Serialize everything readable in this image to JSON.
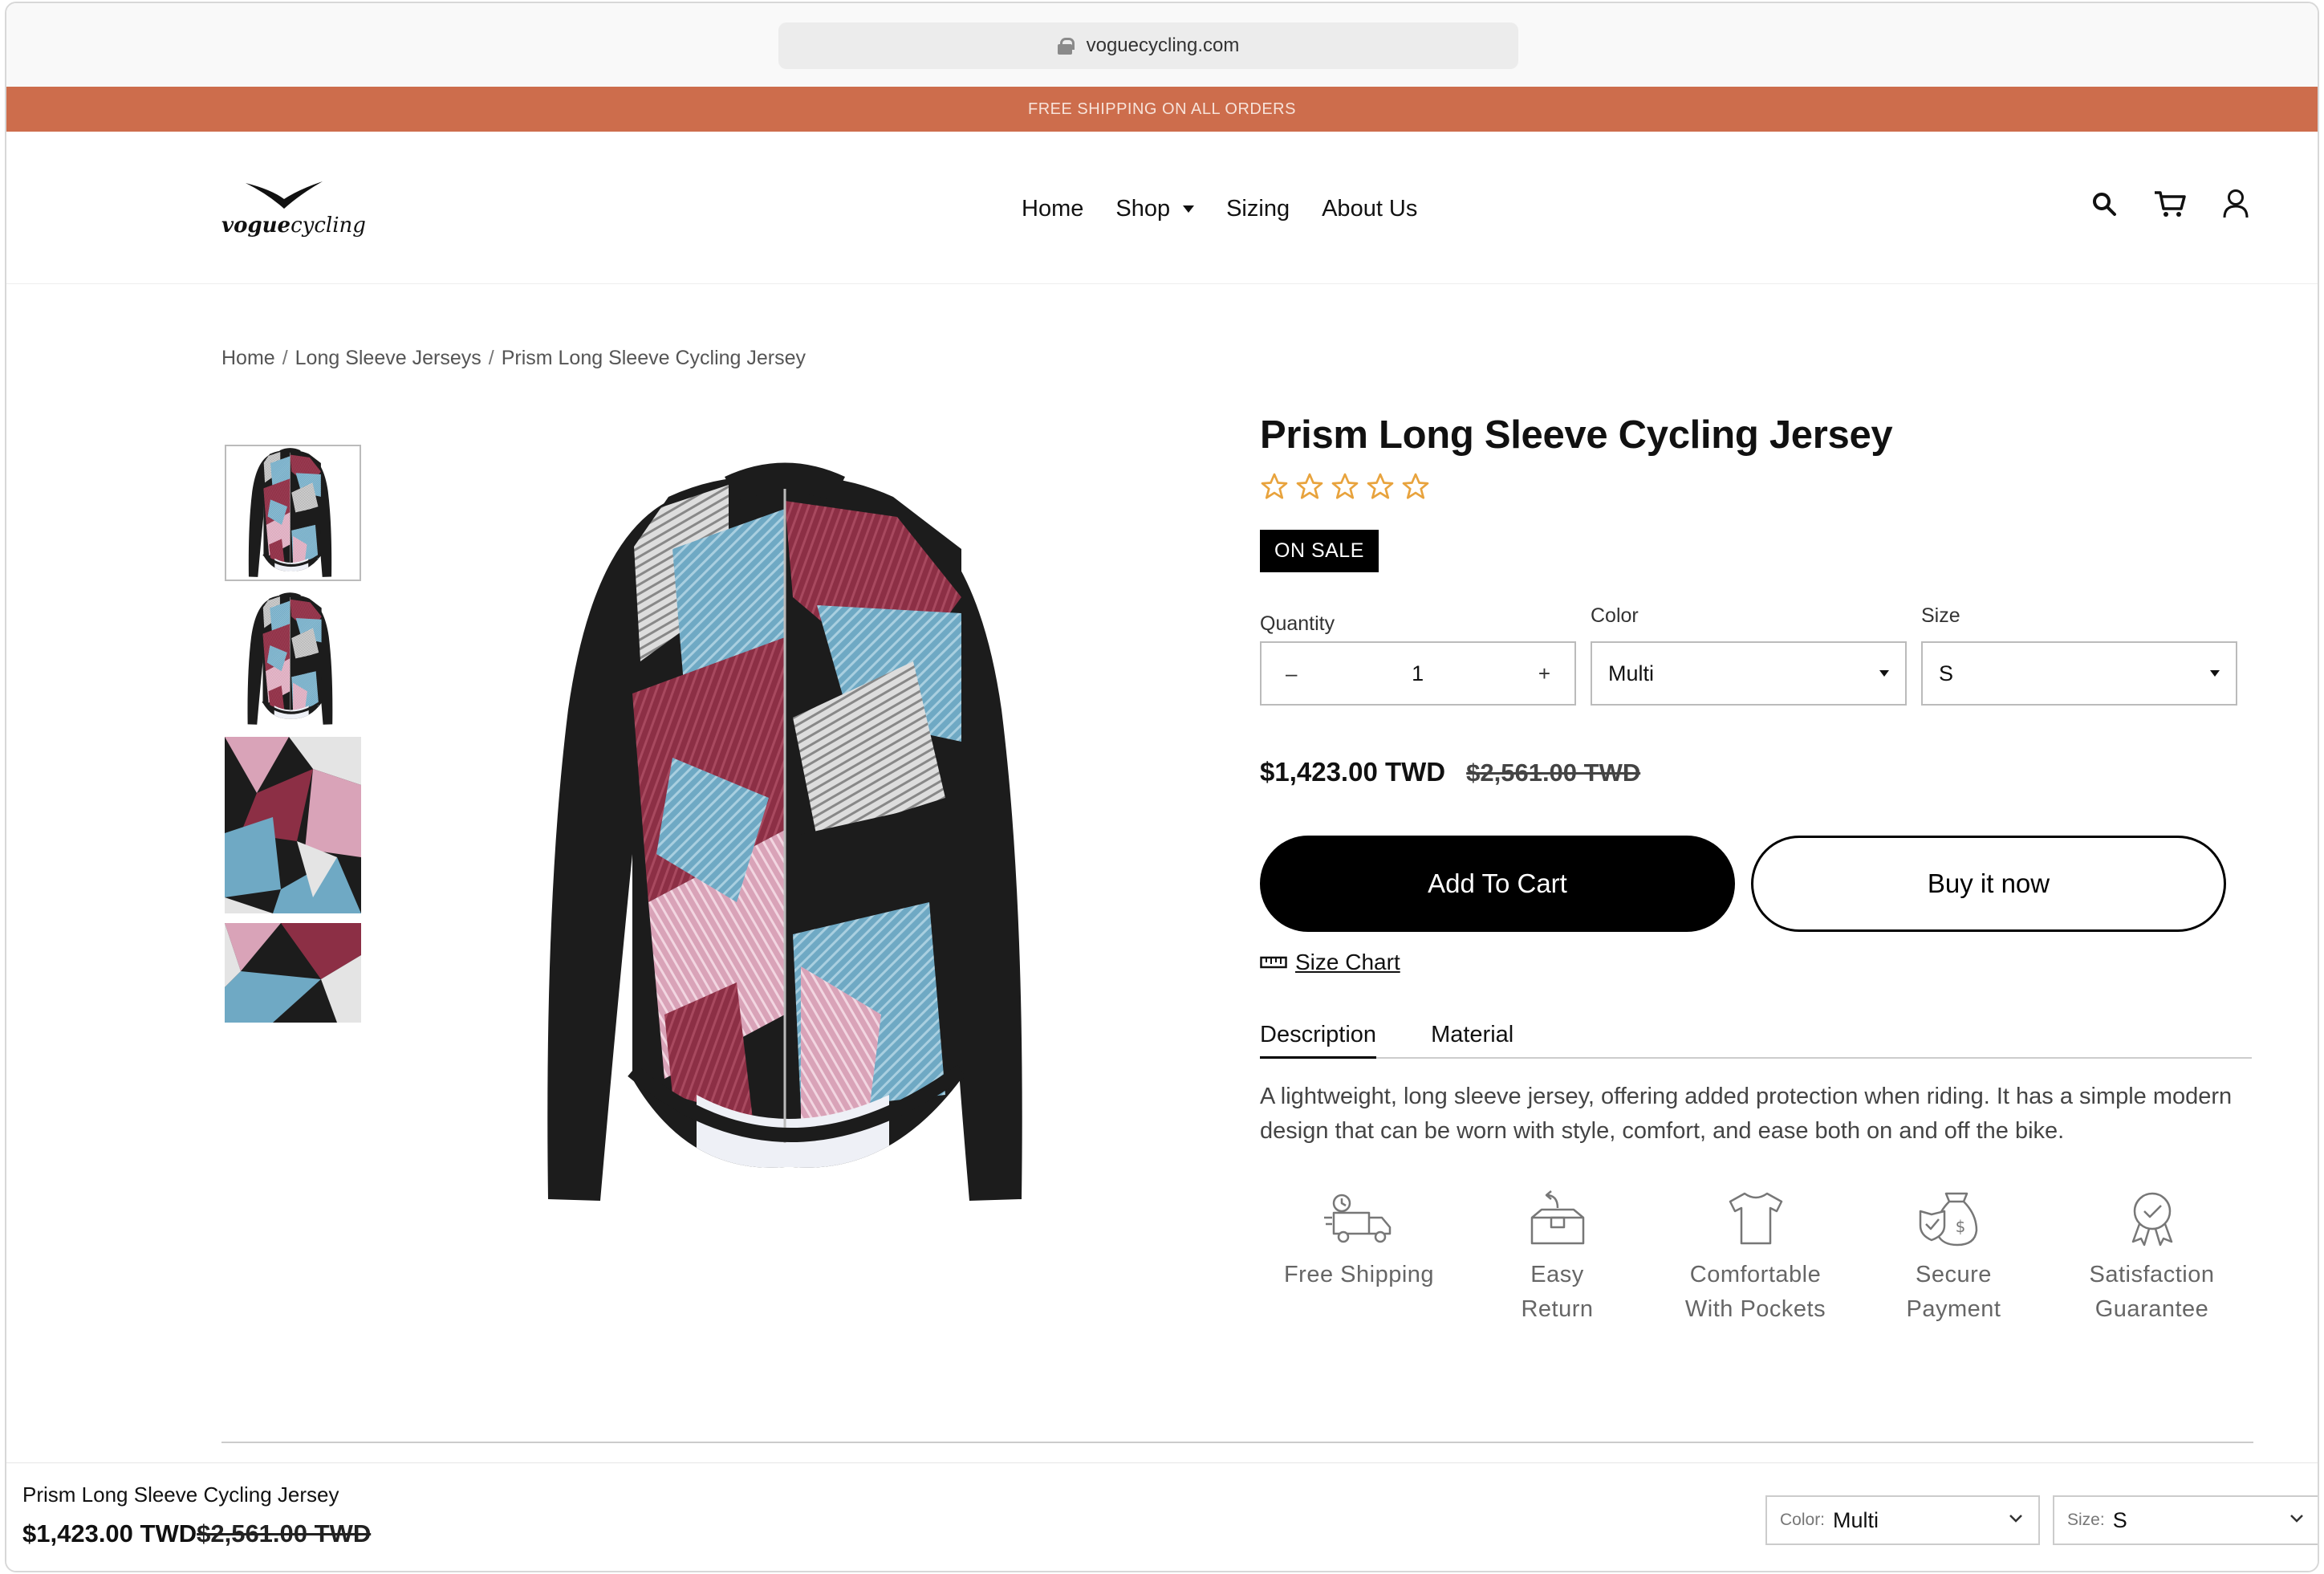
{
  "browser": {
    "url": "voguecycling.com"
  },
  "promo": {
    "text": "FREE SHIPPING ON ALL ORDERS"
  },
  "header": {
    "logo": {
      "bold": "vogue",
      "light": "cycling"
    },
    "nav": [
      {
        "label": "Home"
      },
      {
        "label": "Shop"
      },
      {
        "label": "Sizing"
      },
      {
        "label": "About Us"
      }
    ],
    "icons": [
      "search-icon",
      "cart-icon",
      "account-icon"
    ]
  },
  "breadcrumb": [
    "Home",
    "Long Sleeve Jerseys",
    "Prism Long Sleeve Cycling Jersey"
  ],
  "product": {
    "title": "Prism Long Sleeve Cycling Jersey",
    "rating": 0,
    "rating_max": 5,
    "badge": "ON SALE",
    "quantity": {
      "label": "Quantity",
      "value": "1",
      "minus": "–",
      "plus": "+"
    },
    "color": {
      "label": "Color",
      "value": "Multi"
    },
    "size": {
      "label": "Size",
      "value": "S"
    },
    "price_now": "$1,423.00 TWD",
    "price_was": "$2,561.00 TWD",
    "add_to_cart": "Add To Cart",
    "buy_now": "Buy it now",
    "size_chart": "Size Chart",
    "tabs": [
      {
        "label": "Description",
        "active": true
      },
      {
        "label": "Material",
        "active": false
      }
    ],
    "description": "A lightweight, long sleeve jersey, offering added protection when riding. It has a simple modern design that can be worn with style, comfort, and ease both on and off the bike.",
    "features": [
      {
        "line1": "Free Shipping",
        "line2": "",
        "icon": "delivery-truck-icon"
      },
      {
        "line1": "Easy",
        "line2": "Return",
        "icon": "return-box-icon"
      },
      {
        "line1": "Comfortable",
        "line2": "With Pockets",
        "icon": "tshirt-icon"
      },
      {
        "line1": "Secure",
        "line2": "Payment",
        "icon": "money-bag-icon"
      },
      {
        "line1": "Satisfaction",
        "line2": "Guarantee",
        "icon": "award-badge-icon"
      }
    ]
  },
  "sticky_bar": {
    "title": "Prism Long Sleeve Cycling Jersey",
    "price_now": "$1,423.00 TWD",
    "price_was": "$2,561.00 TWD",
    "color_label": "Color:",
    "color_value": "Multi",
    "size_label": "Size:",
    "size_value": "S"
  },
  "colors": {
    "promo": "#cd6d4c",
    "star": "#e8a33d",
    "jersey_blue": "#6fa9c4",
    "jersey_maroon": "#8c2f45",
    "jersey_pink": "#d9a3b8",
    "jersey_black": "#1c1c1c"
  }
}
